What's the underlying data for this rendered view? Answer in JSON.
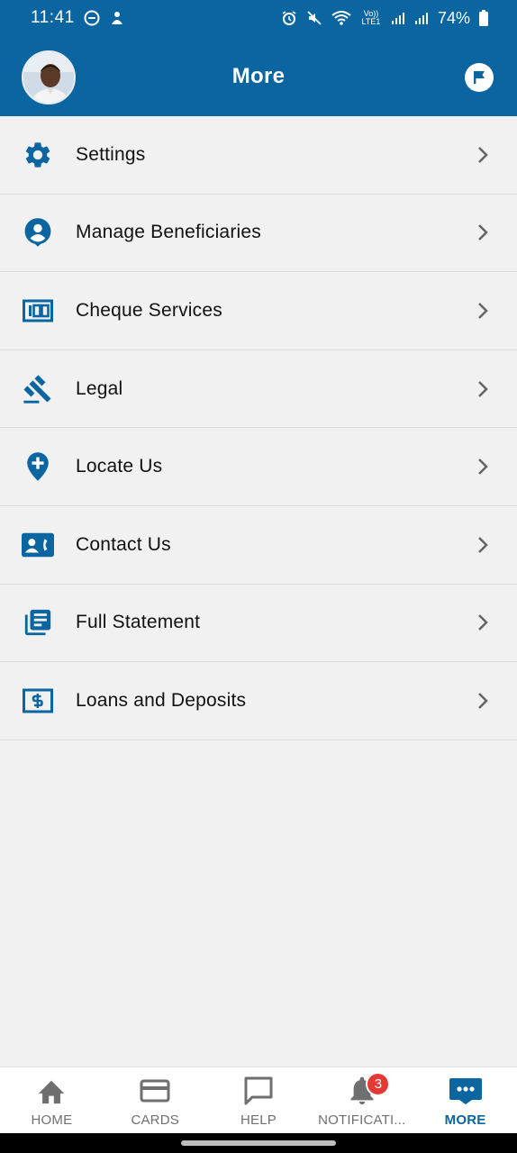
{
  "status_bar": {
    "time": "11:41",
    "battery_pct": "74%",
    "network": "Vo)) LTE1"
  },
  "header": {
    "title": "More"
  },
  "menu": {
    "items": [
      {
        "label": "Settings",
        "icon": "gear-icon"
      },
      {
        "label": "Manage Beneficiaries",
        "icon": "person-pin-icon"
      },
      {
        "label": "Cheque Services",
        "icon": "cheque-icon"
      },
      {
        "label": "Legal",
        "icon": "gavel-icon"
      },
      {
        "label": "Locate Us",
        "icon": "add-location-icon"
      },
      {
        "label": "Contact Us",
        "icon": "contact-phone-icon"
      },
      {
        "label": "Full Statement",
        "icon": "statement-icon"
      },
      {
        "label": "Loans and Deposits",
        "icon": "dollar-box-icon"
      }
    ]
  },
  "bottom_nav": {
    "items": [
      {
        "label": "HOME",
        "icon": "home-icon",
        "active": false
      },
      {
        "label": "CARDS",
        "icon": "card-icon",
        "active": false
      },
      {
        "label": "HELP",
        "icon": "chat-bubble-icon",
        "active": false
      },
      {
        "label": "NOTIFICATI...",
        "icon": "bell-icon",
        "active": false,
        "badge": "3"
      },
      {
        "label": "MORE",
        "icon": "more-icon",
        "active": true
      }
    ]
  },
  "colors": {
    "brand": "#0a65a0",
    "icon_blue": "#0a65a0",
    "badge_red": "#e53935",
    "background": "#f1f1f1"
  }
}
